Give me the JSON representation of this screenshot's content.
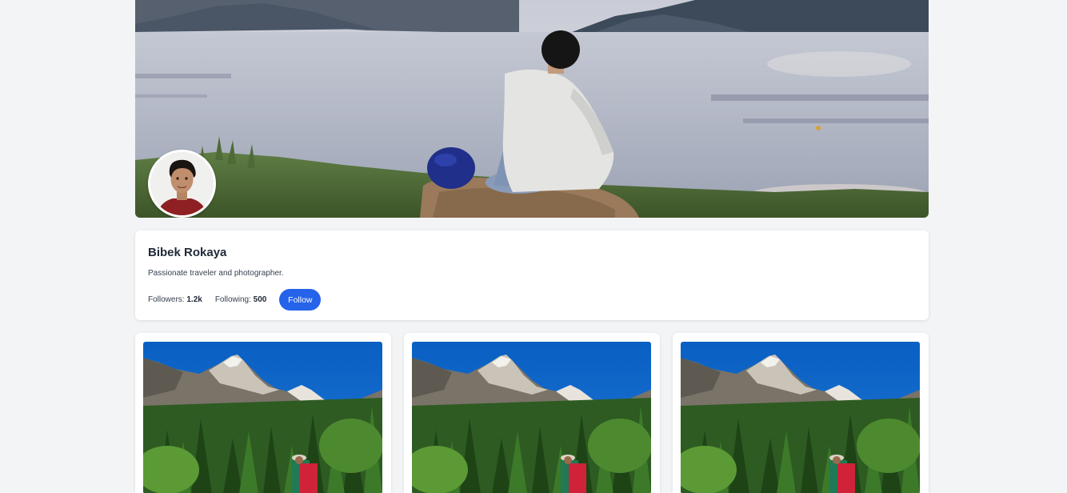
{
  "profile": {
    "name": "Bibek Rokaya",
    "bio": "Passionate traveler and photographer.",
    "followers_label": "Followers:",
    "followers_count": "1.2k",
    "following_label": "Following:",
    "following_count": "500",
    "follow_button": "Follow"
  },
  "images": {
    "cover": "lake-landscape-person-sitting",
    "avatar": "profile-portrait",
    "posts": [
      "mountain-forest-hiker",
      "mountain-forest-hiker",
      "mountain-forest-hiker"
    ]
  },
  "colors": {
    "page_background": "#f3f4f6",
    "card_background": "#ffffff",
    "accent": "#2563eb"
  }
}
